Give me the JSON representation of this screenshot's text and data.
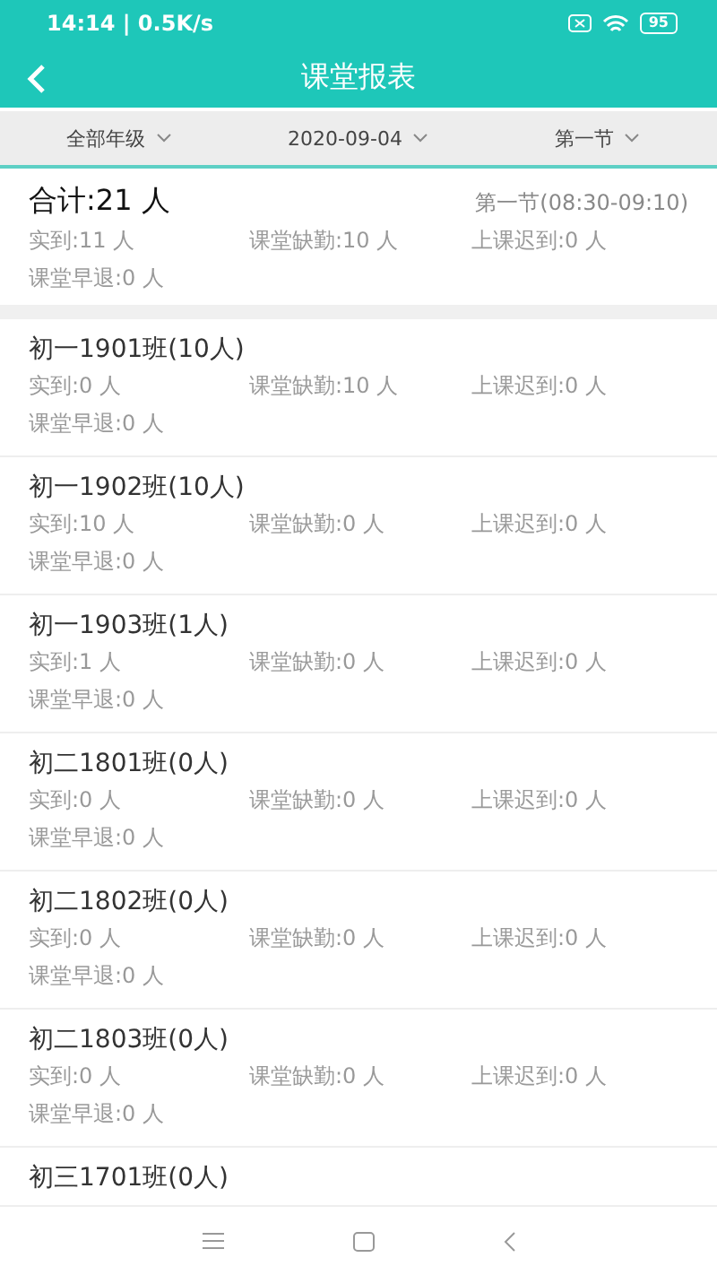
{
  "status_bar": {
    "time": "14:14 | 0.5K/s",
    "battery": "95"
  },
  "header": {
    "title": "课堂报表"
  },
  "filters": [
    {
      "label": "全部年级"
    },
    {
      "label": "2020-09-04"
    },
    {
      "label": "第一节"
    }
  ],
  "summary": {
    "total": "合计:21 人",
    "period": "第一节(08:30-09:10)",
    "stats": [
      "实到:11 人",
      "课堂缺勤:10 人",
      "上课迟到:0 人",
      "课堂早退:0 人"
    ]
  },
  "classes": [
    {
      "name": "初一1901班(10人)",
      "stats": [
        "实到:0 人",
        "课堂缺勤:10 人",
        "上课迟到:0 人",
        "课堂早退:0 人"
      ]
    },
    {
      "name": "初一1902班(10人)",
      "stats": [
        "实到:10 人",
        "课堂缺勤:0 人",
        "上课迟到:0 人",
        "课堂早退:0 人"
      ]
    },
    {
      "name": "初一1903班(1人)",
      "stats": [
        "实到:1 人",
        "课堂缺勤:0 人",
        "上课迟到:0 人",
        "课堂早退:0 人"
      ]
    },
    {
      "name": "初二1801班(0人)",
      "stats": [
        "实到:0 人",
        "课堂缺勤:0 人",
        "上课迟到:0 人",
        "课堂早退:0 人"
      ]
    },
    {
      "name": "初二1802班(0人)",
      "stats": [
        "实到:0 人",
        "课堂缺勤:0 人",
        "上课迟到:0 人",
        "课堂早退:0 人"
      ]
    },
    {
      "name": "初二1803班(0人)",
      "stats": [
        "实到:0 人",
        "课堂缺勤:0 人",
        "上课迟到:0 人",
        "课堂早退:0 人"
      ]
    },
    {
      "name": "初三1701班(0人)"
    }
  ]
}
